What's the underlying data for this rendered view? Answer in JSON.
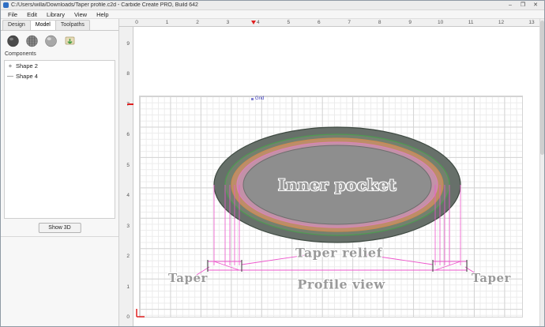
{
  "window": {
    "title": "C:/Users/willa/Downloads/Taper profile.c2d - Carbide Create PRO, Build 642",
    "minimize": "–",
    "maximize": "❐",
    "close": "✕"
  },
  "menu": {
    "items": [
      "File",
      "Edit",
      "Library",
      "View",
      "Help"
    ]
  },
  "sidebar": {
    "tabs": [
      {
        "label": "Design"
      },
      {
        "label": "Model"
      },
      {
        "label": "Toolpaths"
      }
    ],
    "active_tab": "Model",
    "toolbar_icons": [
      "add-shape-sphere",
      "add-texture-sphere",
      "shape-sphere",
      "import-component"
    ],
    "components_header": "Components",
    "component_items": [
      {
        "toggle": "+",
        "label": "Shape 2"
      },
      {
        "toggle": "—",
        "label": "Shape 4"
      }
    ],
    "show_3d": "Show 3D"
  },
  "rulers": {
    "horizontal": [
      "0",
      "1",
      "2",
      "3",
      "4",
      "5",
      "6",
      "7",
      "8",
      "9",
      "10",
      "11",
      "12",
      "13"
    ],
    "vertical": [
      "9",
      "8",
      "7",
      "6",
      "5",
      "4",
      "3",
      "2",
      "1",
      "0"
    ]
  },
  "canvas": {
    "grid_label": "Grid",
    "labels": {
      "inner_pocket": "Inner pocket",
      "taper_relief": "Taper relief",
      "taper_left": "Taper",
      "taper_right": "Taper",
      "profile_view": "Profile view"
    },
    "colors": {
      "magenta": "#ee55cc",
      "outer_band": "#67706a",
      "outer_edge": "#3f4a42",
      "green_band": "#74806f",
      "green_ring": "#4e9a51",
      "orange_band": "#bd8d68",
      "orange_ring": "#c98a52",
      "pink_band": "#c391a8",
      "pink_ring": "#da84b6",
      "pocket_fill": "#8e8e8e",
      "pocket_edge": "#6e6e6e",
      "origin_red": "#e02020"
    }
  }
}
